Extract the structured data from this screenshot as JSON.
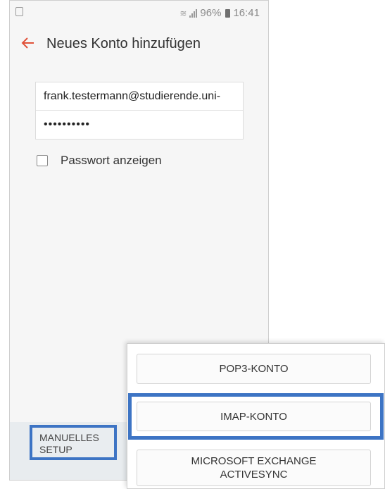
{
  "statusbar": {
    "battery": "96%",
    "time": "16:41"
  },
  "appbar": {
    "title": "Neues Konto hinzufügen"
  },
  "form": {
    "email": "frank.testermann@studierende.uni-",
    "password_masked": "••••••••••"
  },
  "show_password": {
    "label": "Passwort anzeigen"
  },
  "bottom": {
    "manual_setup": "MANUELLES\nSETUP"
  },
  "popup": {
    "pop3": "POP3-KONTO",
    "imap": "IMAP-KONTO",
    "exchange": "MICROSOFT EXCHANGE\nACTIVESYNC"
  },
  "colors": {
    "accent": "#e0523a",
    "highlight": "#3d74c4"
  }
}
